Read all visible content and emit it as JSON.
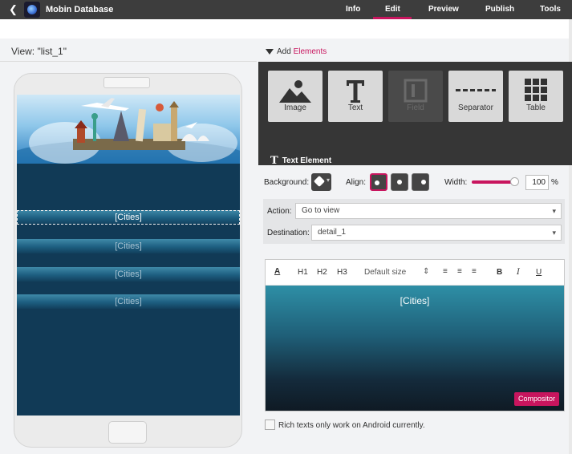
{
  "app": {
    "title": "Mobin Database"
  },
  "nav": {
    "tabs": [
      {
        "label": "Info"
      },
      {
        "label": "Edit"
      },
      {
        "label": "Preview"
      },
      {
        "label": "Publish"
      },
      {
        "label": "Tools"
      }
    ],
    "active": "Edit"
  },
  "view": {
    "title": "View: \"list_1\""
  },
  "phone": {
    "rows": [
      "[Cities]",
      "[Cities]",
      "[Cities]",
      "[Cities]"
    ]
  },
  "add_elements": {
    "prefix": "Add",
    "highlight": "Elements"
  },
  "tools": [
    {
      "label": "Image",
      "icon": "image-icon"
    },
    {
      "label": "Text",
      "icon": "text-icon"
    },
    {
      "label": "Field",
      "icon": "field-icon",
      "disabled": true
    },
    {
      "label": "Separator",
      "icon": "separator-icon"
    },
    {
      "label": "Table",
      "icon": "table-icon"
    }
  ],
  "element": {
    "title": "Text Element"
  },
  "props": {
    "background_label": "Background:",
    "align_label": "Align:",
    "width_label": "Width:",
    "width_value": "100",
    "width_unit": "%",
    "width_fraction": 1.0
  },
  "action": {
    "label": "Action:",
    "value": "Go to view"
  },
  "destination": {
    "label": "Destination:",
    "value": "detail_1"
  },
  "editor": {
    "toolbar": {
      "h1": "H1",
      "h2": "H2",
      "h3": "H3",
      "size": "Default size",
      "bold": "B",
      "italic": "I",
      "underline": "U"
    },
    "content": "[Cities]",
    "compositor": "Compositor"
  },
  "note": {
    "text": "Rich texts only work on Android currently."
  },
  "colors": {
    "accent": "#c8155e",
    "topbar": "#3d3d3d",
    "screen": "#113a56"
  }
}
